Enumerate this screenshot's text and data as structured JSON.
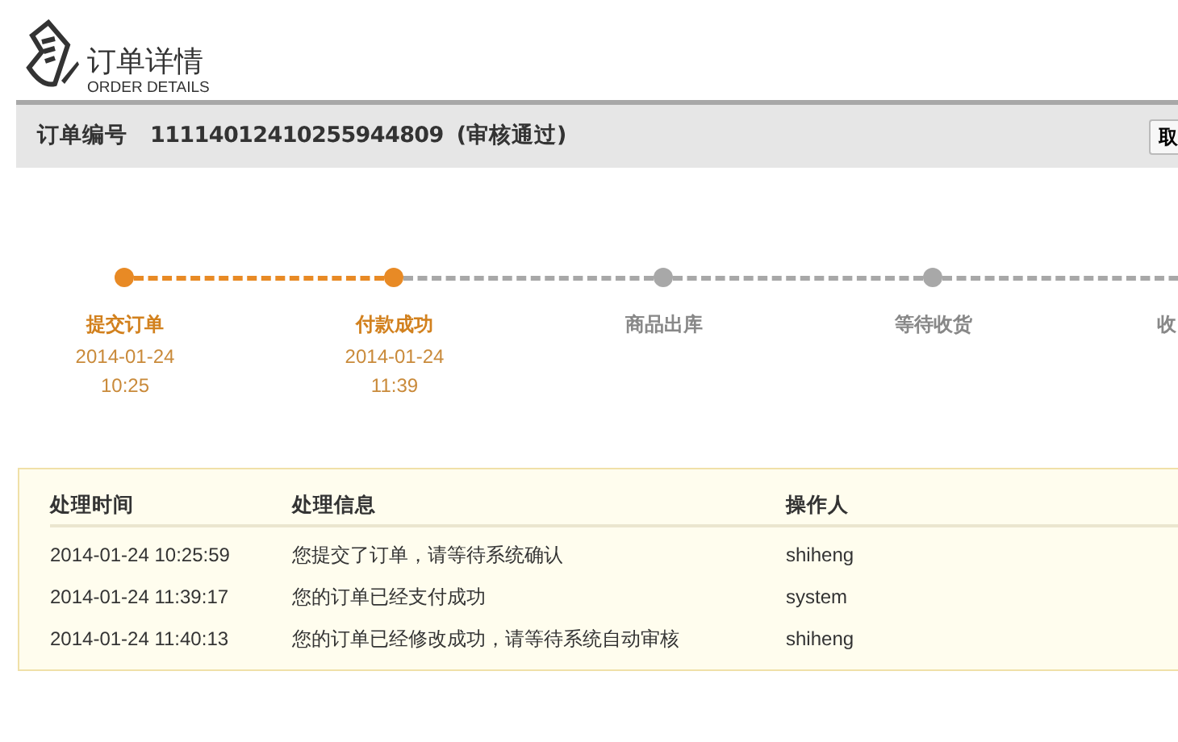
{
  "header": {
    "title": "订单详情",
    "subtitle": "ORDER DETAILS"
  },
  "order": {
    "label": "订单编号",
    "number": "11114012410255944809",
    "status": "(审核通过)",
    "button": "取"
  },
  "steps": [
    {
      "label": "提交订单",
      "date": "2014-01-24",
      "time": "10:25",
      "done": true
    },
    {
      "label": "付款成功",
      "date": "2014-01-24",
      "time": "11:39",
      "done": true
    },
    {
      "label": "商品出库",
      "done": false
    },
    {
      "label": "等待收货",
      "done": false
    },
    {
      "label": "收",
      "done": false
    }
  ],
  "log": {
    "columns": [
      "处理时间",
      "处理信息",
      "操作人"
    ],
    "rows": [
      [
        "2014-01-24 10:25:59",
        "您提交了订单，请等待系统确认",
        "shiheng"
      ],
      [
        "2014-01-24 11:39:17",
        "您的订单已经支付成功",
        "system"
      ],
      [
        "2014-01-24 11:40:13",
        "您的订单已经修改成功，请等待系统自动审核",
        "shiheng"
      ]
    ]
  }
}
